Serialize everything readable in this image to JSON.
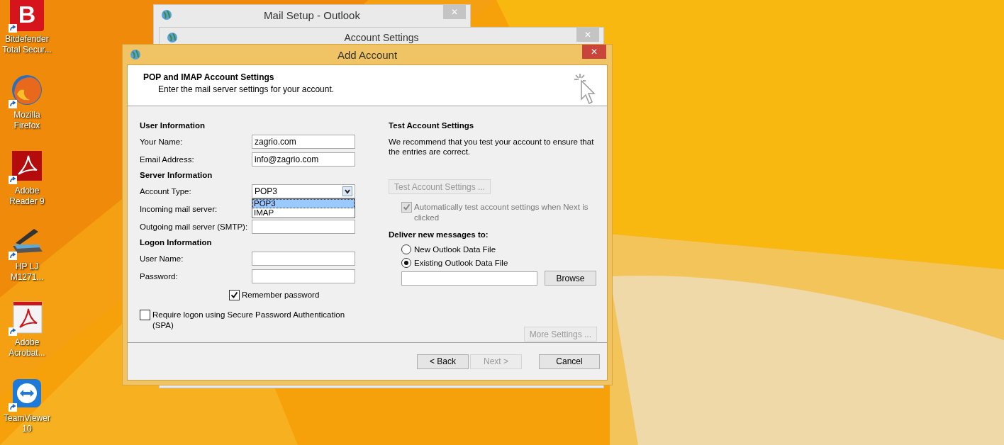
{
  "desktop_icons": [
    {
      "label": "Bitdefender Total Secur...",
      "kind": "bitdefender",
      "glyph": "B"
    },
    {
      "label": "Mozilla Firefox",
      "kind": "firefox"
    },
    {
      "label": "Adobe Reader 9",
      "kind": "reader"
    },
    {
      "label": "HP LJ M1271...",
      "kind": "scanner"
    },
    {
      "label": "Adobe Acrobat...",
      "kind": "acrobat"
    },
    {
      "label": "TeamViewer 10",
      "kind": "teamviewer"
    }
  ],
  "back_windows": [
    {
      "title": "Mail Setup - Outlook"
    },
    {
      "title": "Account Settings"
    }
  ],
  "dialog": {
    "title": "Add Account",
    "close": "✕",
    "header": {
      "title": "POP and IMAP Account Settings",
      "subtitle": "Enter the mail server settings for your account."
    },
    "left_sections": [
      {
        "heading": "User Information",
        "rows": [
          {
            "label": "Your Name:",
            "kind": "text",
            "value": "zagrio.com"
          },
          {
            "label": "Email Address:",
            "kind": "text",
            "value": "info@zagrio.com"
          }
        ]
      },
      {
        "heading": "Server Information",
        "rows": [
          {
            "label": "Account Type:",
            "kind": "combo",
            "value": "POP3",
            "options": [
              {
                "label": "POP3",
                "selected": true
              },
              {
                "label": "IMAP",
                "selected": false
              }
            ]
          },
          {
            "label": "Incoming mail server:",
            "kind": "hidden"
          },
          {
            "label": "Outgoing mail server (SMTP):",
            "kind": "text"
          }
        ]
      },
      {
        "heading": "Logon Information",
        "rows": [
          {
            "label": "User Name:",
            "kind": "text"
          },
          {
            "label": "Password:",
            "kind": "text"
          }
        ]
      }
    ],
    "remember_password": {
      "label": "Remember password",
      "checked": true
    },
    "spa": {
      "label": "Require logon using Secure Password Authentication (SPA)",
      "checked": false
    },
    "test": {
      "heading": "Test Account Settings",
      "text": "We recommend that you test your account to ensure that the entries are correct.",
      "button": {
        "label": "Test Account Settings ...",
        "disabled": true
      },
      "auto_test": {
        "label": "Automatically test account settings when Next is clicked",
        "checked": true,
        "disabled": true
      }
    },
    "deliver": {
      "heading": "Deliver new messages to:",
      "options": [
        {
          "label": "New Outlook Data File",
          "selected": false
        },
        {
          "label": "Existing Outlook Data File",
          "selected": true
        }
      ],
      "browse": "Browse"
    },
    "more_settings": {
      "label": "More Settings ...",
      "disabled": true
    },
    "buttons": [
      {
        "label": "< Back",
        "disabled": false
      },
      {
        "label": "Next >",
        "disabled": true
      },
      {
        "label": "Cancel",
        "disabled": false
      }
    ]
  }
}
